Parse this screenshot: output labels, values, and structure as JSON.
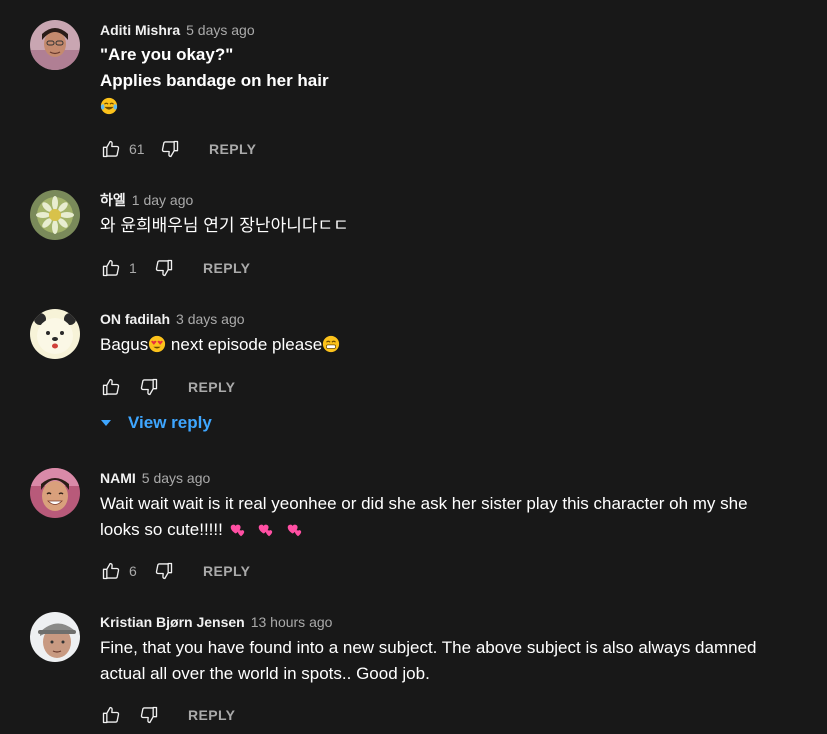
{
  "comments": [
    {
      "author": "Aditi Mishra",
      "time": "5 days ago",
      "lines": [
        "\"Are you okay?\"",
        "Applies bandage on her hair"
      ],
      "emoji_line": "laughing-tears-emoji",
      "likes": "61",
      "reply_label": "REPLY"
    },
    {
      "author": "하엘",
      "time": "1 day ago",
      "lines": [
        "와 윤희배우님 연기 장난아니다ㄷㄷ"
      ],
      "likes": "1",
      "reply_label": "REPLY"
    },
    {
      "author": "ON fadilah",
      "time": "3 days ago",
      "text_part1": "Bagus",
      "text_part2": " next episode please",
      "likes": "",
      "reply_label": "REPLY",
      "view_reply_label": "View reply"
    },
    {
      "author": "NAMI",
      "time": "5 days ago",
      "lines": [
        "Wait wait wait is it real yeonhee or did she ask her sister play this character oh my she"
      ],
      "line2": "looks so cute!!!!! ",
      "likes": "6",
      "reply_label": "REPLY"
    },
    {
      "author": "Kristian Bjørn Jensen",
      "time": "13 hours ago",
      "lines": [
        "Fine, that you have found  into a new subject. The above subject is also always damned",
        "actual all over the world in spots..  Good job."
      ],
      "likes": "",
      "reply_label": "REPLY"
    }
  ],
  "icons": {
    "like": "thumbs-up-outline-icon",
    "dislike": "thumbs-down-outline-icon",
    "expand": "caret-down-icon"
  },
  "colors": {
    "background": "#181818",
    "text_primary": "#ffffff",
    "text_secondary": "#aaaaaa",
    "link_blue": "#3ea6ff"
  }
}
